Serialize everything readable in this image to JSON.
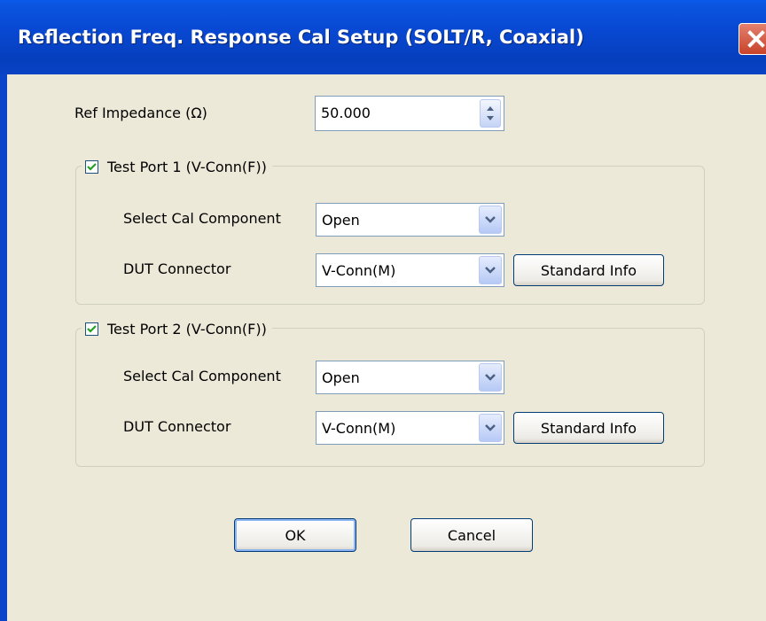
{
  "dialog": {
    "title": "Reflection Freq. Response Cal Setup (SOLT/R, Coaxial)"
  },
  "ref_impedance": {
    "label": "Ref Impedance (Ω)",
    "value": "50.000"
  },
  "port1": {
    "label": "Test Port 1 (V-Conn(F))",
    "checked": true,
    "select_label": "Select Cal Component",
    "select_value": "Open",
    "dut_label": "DUT Connector",
    "dut_value": "V-Conn(M)",
    "std_button": "Standard Info"
  },
  "port2": {
    "label": "Test Port 2 (V-Conn(F))",
    "checked": true,
    "select_label": "Select Cal Component",
    "select_value": "Open",
    "dut_label": "DUT Connector",
    "dut_value": "V-Conn(M)",
    "std_button": "Standard Info"
  },
  "buttons": {
    "ok": "OK",
    "cancel": "Cancel"
  },
  "colors": {
    "title_bar": "#0848D2",
    "face": "#ECE9D8",
    "check": "#21A121"
  }
}
